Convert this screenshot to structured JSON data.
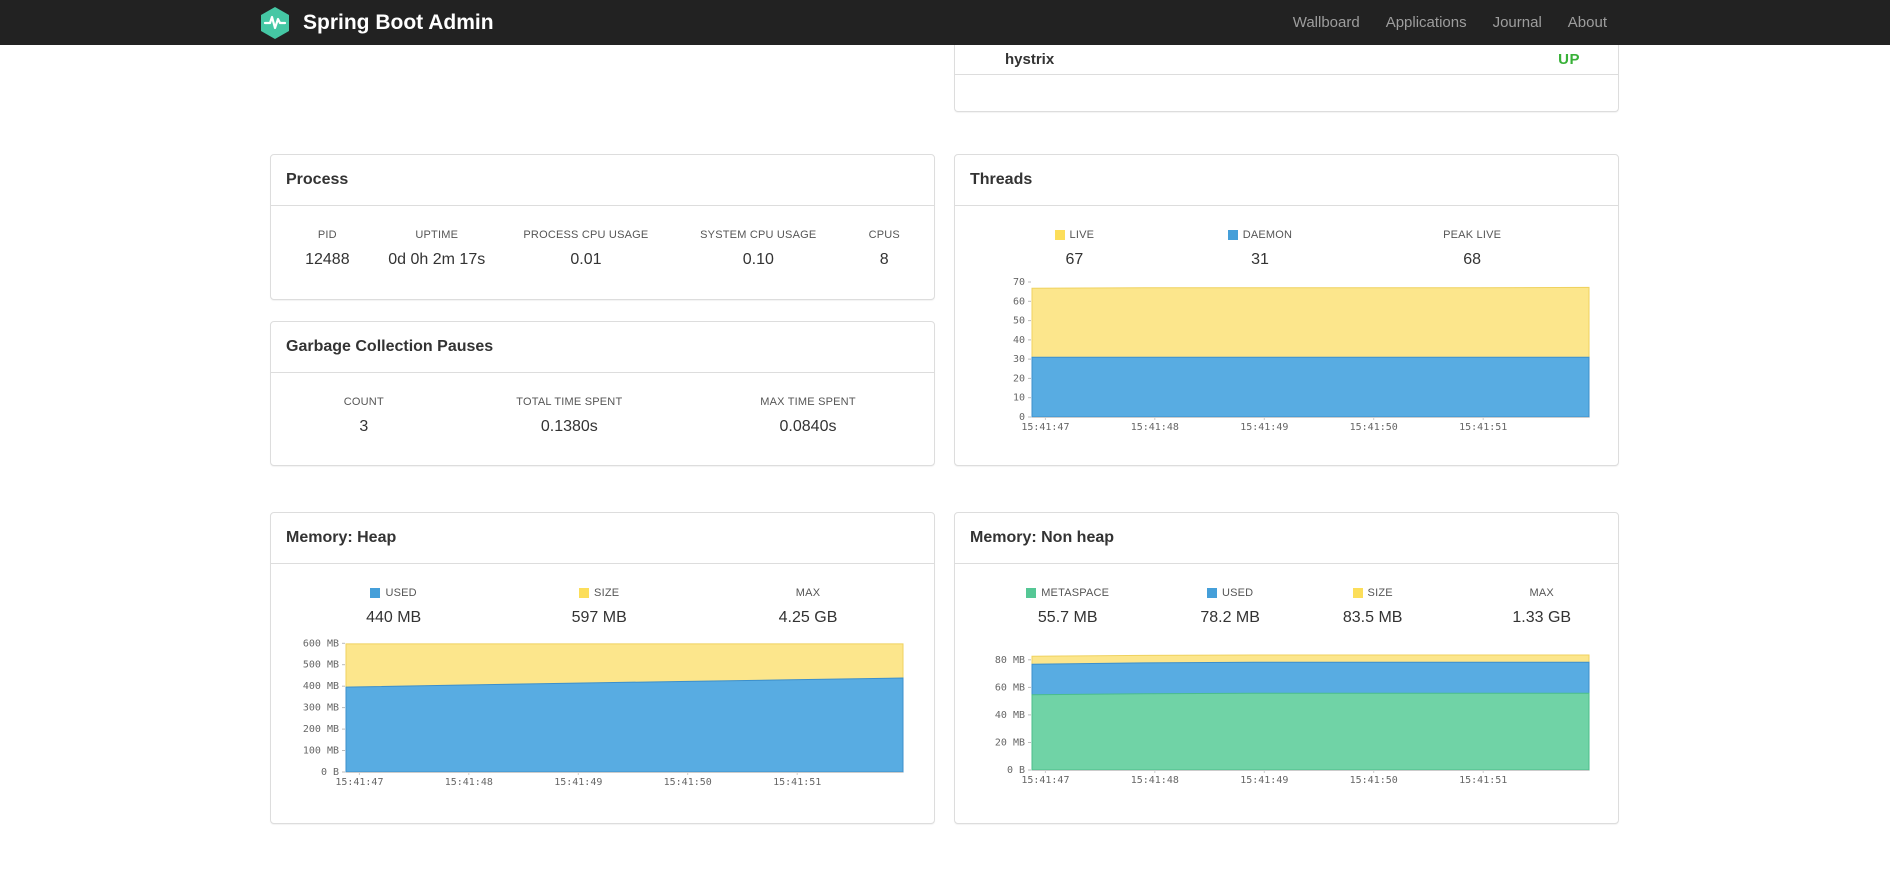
{
  "navbar": {
    "brand": "Spring Boot Admin",
    "links": [
      {
        "label": "Wallboard"
      },
      {
        "label": "Applications"
      },
      {
        "label": "Journal"
      },
      {
        "label": "About"
      }
    ]
  },
  "status_panel": {
    "application": "hystrix",
    "status": "UP",
    "status_color": "#38B138"
  },
  "process": {
    "title": "Process",
    "metrics": [
      {
        "label": "PID",
        "value": "12488"
      },
      {
        "label": "UPTIME",
        "value": "0d 0h 2m 17s"
      },
      {
        "label": "PROCESS CPU USAGE",
        "value": "0.01"
      },
      {
        "label": "SYSTEM CPU USAGE",
        "value": "0.10"
      },
      {
        "label": "CPUS",
        "value": "8"
      }
    ]
  },
  "gc": {
    "title": "Garbage Collection Pauses",
    "metrics": [
      {
        "label": "COUNT",
        "value": "3"
      },
      {
        "label": "TOTAL TIME SPENT",
        "value": "0.1380s"
      },
      {
        "label": "MAX TIME SPENT",
        "value": "0.0840s"
      }
    ]
  },
  "threads": {
    "title": "Threads",
    "legend": [
      {
        "label": "LIVE",
        "value": "67",
        "color": "#FCDE5A"
      },
      {
        "label": "DAEMON",
        "value": "31",
        "color": "#459FD9"
      },
      {
        "label": "PEAK LIVE",
        "value": "68"
      }
    ]
  },
  "heap": {
    "title": "Memory: Heap",
    "legend": [
      {
        "label": "USED",
        "value": "440 MB",
        "color": "#459FD9"
      },
      {
        "label": "SIZE",
        "value": "597 MB",
        "color": "#FCDE5A"
      },
      {
        "label": "MAX",
        "value": "4.25 GB"
      }
    ]
  },
  "nonheap": {
    "title": "Memory: Non heap",
    "legend": [
      {
        "label": "METASPACE",
        "value": "55.7 MB",
        "color": "#55C795"
      },
      {
        "label": "USED",
        "value": "78.2 MB",
        "color": "#459FD9"
      },
      {
        "label": "SIZE",
        "value": "83.5 MB",
        "color": "#FCDE5A"
      },
      {
        "label": "MAX",
        "value": "1.33 GB"
      }
    ]
  },
  "chart_data": [
    {
      "id": "threads",
      "type": "area",
      "title": "Threads",
      "x_ticks": [
        "15:41:47",
        "15:41:48",
        "15:41:49",
        "15:41:50",
        "15:41:51"
      ],
      "y_ticks": [
        {
          "v": 0,
          "label": "0"
        },
        {
          "v": 10,
          "label": "10"
        },
        {
          "v": 20,
          "label": "20"
        },
        {
          "v": 30,
          "label": "30"
        },
        {
          "v": 40,
          "label": "40"
        },
        {
          "v": 50,
          "label": "50"
        },
        {
          "v": 60,
          "label": "60"
        },
        {
          "v": 70,
          "label": "70"
        }
      ],
      "ymax": 70,
      "series": [
        {
          "name": "LIVE",
          "values": [
            66.8,
            67,
            67,
            67,
            67,
            67.2
          ],
          "fill": "#FCE68C",
          "stroke": "#EFD25F"
        },
        {
          "name": "DAEMON",
          "values": [
            31,
            31,
            31,
            31,
            31,
            31
          ],
          "fill": "#58ACE2",
          "stroke": "#3C8FCB"
        }
      ]
    },
    {
      "id": "heap",
      "type": "area",
      "title": "Memory: Heap",
      "x_ticks": [
        "15:41:47",
        "15:41:48",
        "15:41:49",
        "15:41:50",
        "15:41:51"
      ],
      "y_ticks": [
        {
          "v": 0,
          "label": "0 B"
        },
        {
          "v": 100,
          "label": "100 MB"
        },
        {
          "v": 200,
          "label": "200 MB"
        },
        {
          "v": 300,
          "label": "300 MB"
        },
        {
          "v": 400,
          "label": "400 MB"
        },
        {
          "v": 500,
          "label": "500 MB"
        },
        {
          "v": 600,
          "label": "600 MB"
        }
      ],
      "ymax": 620,
      "series": [
        {
          "name": "SIZE",
          "values": [
            597,
            597,
            597,
            597,
            597,
            597
          ],
          "fill": "#FCE68C",
          "stroke": "#EFD25F"
        },
        {
          "name": "USED",
          "values": [
            396,
            405,
            414,
            422,
            430,
            438
          ],
          "fill": "#58ACE2",
          "stroke": "#3C8FCB"
        }
      ]
    },
    {
      "id": "nonheap",
      "type": "area",
      "title": "Memory: Non heap",
      "x_ticks": [
        "15:41:47",
        "15:41:48",
        "15:41:49",
        "15:41:50",
        "15:41:51"
      ],
      "y_ticks": [
        {
          "v": 0,
          "label": "0 B"
        },
        {
          "v": 20,
          "label": "20 MB"
        },
        {
          "v": 40,
          "label": "40 MB"
        },
        {
          "v": 60,
          "label": "60 MB"
        },
        {
          "v": 80,
          "label": "80 MB"
        }
      ],
      "ymax": 91.5,
      "series": [
        {
          "name": "SIZE",
          "values": [
            82.6,
            83.2,
            83.5,
            83.5,
            83.5,
            83.5
          ],
          "fill": "#FCE68C",
          "stroke": "#EFD25F"
        },
        {
          "name": "USED",
          "values": [
            76.8,
            77.8,
            78.2,
            78.2,
            78.2,
            78.2
          ],
          "fill": "#58ACE2",
          "stroke": "#3C8FCB"
        },
        {
          "name": "METASPACE",
          "values": [
            54.6,
            55.3,
            55.7,
            55.7,
            55.7,
            55.7
          ],
          "fill": "#70D3A6",
          "stroke": "#4BBD8B"
        }
      ]
    }
  ]
}
